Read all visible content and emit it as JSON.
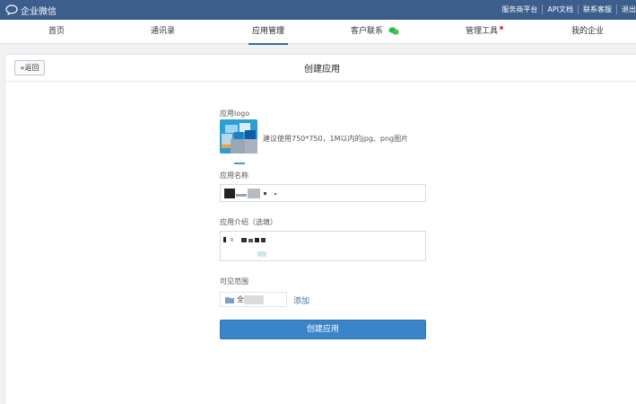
{
  "app": {
    "title": "企业微信"
  },
  "top_links": [
    "服务商平台",
    "API文档",
    "联系客服",
    "退出"
  ],
  "nav": {
    "items": [
      "首页",
      "通讯录",
      "应用管理",
      "客户联系",
      "管理工具",
      "我的企业"
    ],
    "active": "应用管理"
  },
  "page": {
    "back_label": "«返回",
    "title": "创建应用"
  },
  "form": {
    "logo_label": "应用logo",
    "logo_hint": "建议使用750*750，1M以内的jpg、png图片",
    "name_label": "应用名称",
    "intro_label": "应用介绍（选填）",
    "scope_label": "可见范围",
    "scope_value": "全",
    "add_label": "添加",
    "submit_label": "创建应用"
  },
  "colors": {
    "topbar": "#3b5e8c",
    "accent": "#3a84c8",
    "link": "#4a6e94",
    "badge": "#e64340",
    "wechat_green": "#2db84b"
  },
  "icons": [
    "chat-bubble-icon",
    "wechat-icon",
    "red-dot-badge",
    "folder-icon"
  ]
}
